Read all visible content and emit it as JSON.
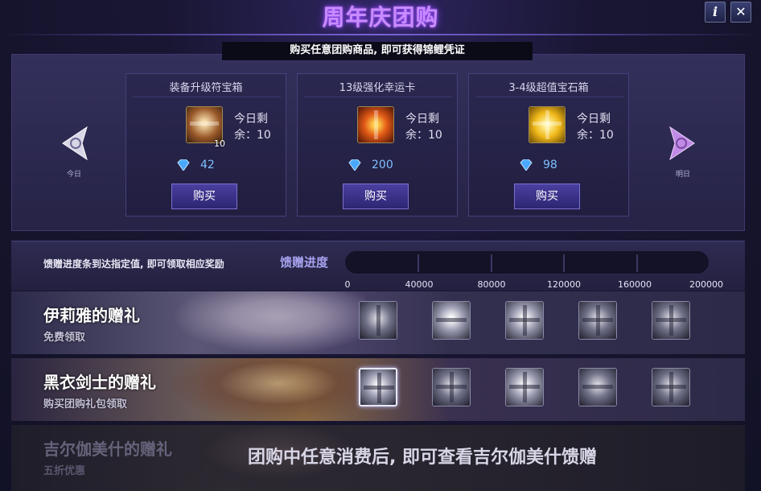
{
  "header": {
    "title": "周年庆团购",
    "info_label": "i",
    "close_label": "✕",
    "subtitle": "购买任意团购商品, 即可获得锦鲤凭证"
  },
  "navigation": {
    "prev_label": "今日",
    "next_label": "明日"
  },
  "shop": {
    "items": [
      {
        "name": "装备升级符宝箱",
        "icon": "treasure-chest-icon",
        "count": "10",
        "stock_line1": "今日剩",
        "stock_line2": "余：10",
        "price": "42",
        "buy_label": "购买"
      },
      {
        "name": "13级强化幸运卡",
        "icon": "lucky-card-icon",
        "count": "",
        "stock_line1": "今日剩",
        "stock_line2": "余：10",
        "price": "200",
        "buy_label": "购买"
      },
      {
        "name": "3-4级超值宝石箱",
        "icon": "gem-gift-box-icon",
        "count": "",
        "stock_line1": "今日剩",
        "stock_line2": "余：10",
        "price": "98",
        "buy_label": "购买"
      }
    ]
  },
  "progress": {
    "hint": "馈赠进度条到达指定值, 即可领取相应奖励",
    "label": "馈赠进度",
    "value_fraction": 0,
    "ticks": [
      "0",
      "40000",
      "80000",
      "120000",
      "160000",
      "200000"
    ]
  },
  "gift_rows": [
    {
      "title": "伊莉雅的赠礼",
      "subtitle": "免费领取",
      "rewards": [
        "card-pack-icon",
        "silver-chest-icon",
        "silver-gift-icon",
        "silver-gift-icon",
        "silver-gift-icon"
      ]
    },
    {
      "title": "黑衣剑士的赠礼",
      "subtitle": "购买团购礼包领取",
      "rewards": [
        "silver-gift-icon",
        "silver-gift-icon",
        "silver-gift-icon",
        "card-pack-icon",
        "silver-gift-icon"
      ]
    },
    {
      "title": "吉尔伽美什的赠礼",
      "subtitle": "五折优惠",
      "locked_message": "团购中任意消费后, 即可查看吉尔伽美什馈赠"
    }
  ],
  "colors": {
    "title_glow": "#c98bff",
    "accent": "#7a70d0",
    "price": "#7ec0ff"
  }
}
